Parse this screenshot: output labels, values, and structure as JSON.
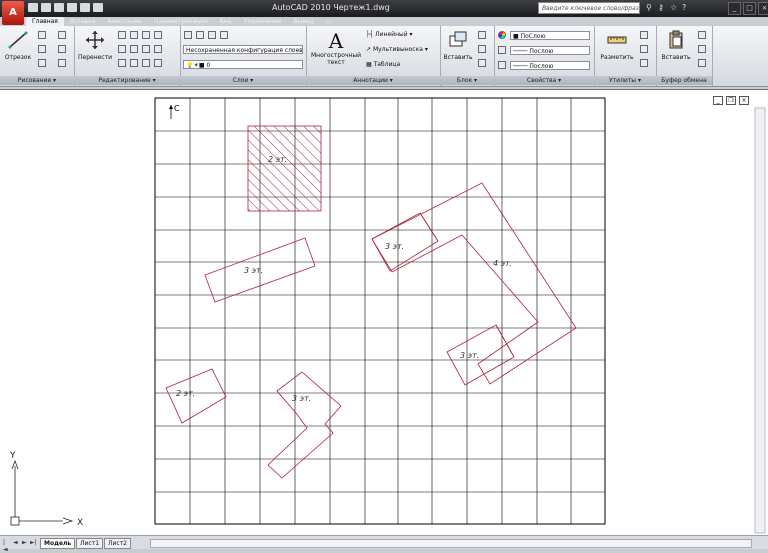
{
  "window": {
    "title": "AutoCAD 2010    Чертеж1.dwg",
    "search_placeholder": "Введите ключевое слово/фразу",
    "app_button": "A"
  },
  "tabs": [
    {
      "label": "Главная",
      "active": true
    },
    {
      "label": "Вставка"
    },
    {
      "label": "Аннотации"
    },
    {
      "label": "Параметризация"
    },
    {
      "label": "Вид"
    },
    {
      "label": "Управление"
    },
    {
      "label": "Вывод"
    }
  ],
  "ribbon": {
    "draw": {
      "line_label": "Отрезок",
      "panel_label": "Рисование ▾"
    },
    "modify": {
      "move_label": "Перенести",
      "panel_label": "Редактирование ▾"
    },
    "layers": {
      "state_combo": "Несохраненная конфигурация слоев",
      "layer_combo": "0",
      "panel_label": "Слои ▾"
    },
    "annotation": {
      "mtext_label": "Многострочный текст",
      "linear_label": "Линейный",
      "multileader_label": "Мультивыноска",
      "table_label": "Таблица",
      "panel_label": "Аннотации ▾"
    },
    "block": {
      "insert_label": "Вставить",
      "panel_label": "Блок ▾"
    },
    "properties": {
      "color_combo": "ПоСлою",
      "linetype_combo": "Послою",
      "lineweight_combo": "Послою",
      "panel_label": "Свойства ▾"
    },
    "utilities": {
      "measure_label": "Разметить",
      "panel_label": "Утилиты ▾"
    },
    "clipboard": {
      "paste_label": "Вставить",
      "panel_label": "Буфер обмена"
    }
  },
  "drawing": {
    "north_label": "С",
    "buildings": [
      {
        "label": "2 эт.",
        "hatched": true
      },
      {
        "label": "3 эт."
      },
      {
        "label": "3 эт."
      },
      {
        "label": "4 эт."
      },
      {
        "label": "3 эт."
      },
      {
        "label": "2 эт."
      },
      {
        "label": "3 эт."
      }
    ]
  },
  "ucs": {
    "x_label": "X",
    "y_label": "Y"
  },
  "layout_tabs": [
    {
      "label": "Модель",
      "active": true
    },
    {
      "label": "Лист1"
    },
    {
      "label": "Лист2"
    }
  ],
  "colors": {
    "building_outline": "#b0203a",
    "hatch": "#b0203a",
    "grid": "#000000",
    "app_red": "#c0231a"
  }
}
